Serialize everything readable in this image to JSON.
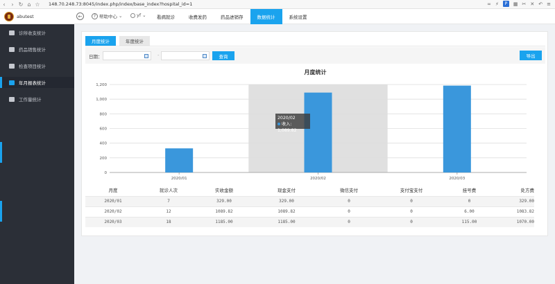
{
  "browser": {
    "address": "148.70.248.73:8045/index.php/index/base_index?hospital_id=1",
    "p_label": "P"
  },
  "header": {
    "brand": "abutest",
    "help_label": "帮助中心",
    "user_label": "yf",
    "nav": [
      {
        "label": "看病就诊"
      },
      {
        "label": "收费发药"
      },
      {
        "label": "药品进销存"
      },
      {
        "label": "数据统计",
        "active": true
      },
      {
        "label": "系统设置"
      }
    ]
  },
  "sidebar": {
    "items": [
      {
        "label": "诊所收支统计",
        "icon": "pie-chart-icon"
      },
      {
        "label": "药品销售统计",
        "icon": "medicine-box-icon"
      },
      {
        "label": "检查项目统计",
        "icon": "bar-chart-icon"
      },
      {
        "label": "年月报表统计",
        "icon": "line-chart-icon",
        "active": true
      },
      {
        "label": "工作量统计",
        "icon": "calculator-icon"
      }
    ]
  },
  "tabs": [
    {
      "label": "月度统计",
      "active": true
    },
    {
      "label": "年度统计"
    }
  ],
  "filter": {
    "date_label": "日期：",
    "date_separator": "-",
    "start_value": "",
    "end_value": "",
    "query_label": "查询",
    "export_label": "导出"
  },
  "chart_data": {
    "type": "bar",
    "title": "月度统计",
    "categories": [
      "2020/01",
      "2020/02",
      "2020/03"
    ],
    "series": [
      {
        "name": "收入",
        "values": [
          329,
          1089.82,
          1185
        ]
      }
    ],
    "ylim": [
      0,
      1200
    ],
    "yticks": [
      "0",
      "200",
      "400",
      "600",
      "800",
      "1,000",
      "1,200"
    ],
    "highlighted_category": "2020/02",
    "tooltip": {
      "title": "2020/02",
      "text": "收入: 1,089.82"
    },
    "grid": true,
    "colors": {
      "bar": "#3a97dc",
      "highlight": "#e0e0e0"
    }
  },
  "table": {
    "headers": [
      "月度",
      "就诊人次",
      "实收金额",
      "现金支付",
      "微信支付",
      "支付宝支付",
      "挂号费",
      "处方费"
    ],
    "rows": [
      [
        "2020/01",
        "7",
        "329.00",
        "329.00",
        "0",
        "0",
        "0",
        "329.00"
      ],
      [
        "2020/02",
        "12",
        "1089.82",
        "1089.82",
        "0",
        "0",
        "6.00",
        "1083.82"
      ],
      [
        "2020/03",
        "18",
        "1185.00",
        "1185.00",
        "0",
        "0",
        "115.00",
        "1070.00"
      ]
    ]
  }
}
